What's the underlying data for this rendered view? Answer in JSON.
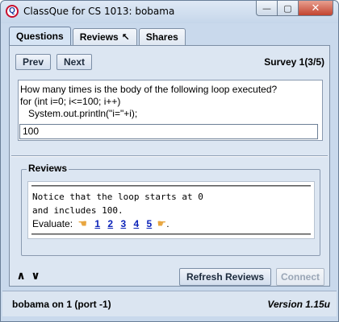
{
  "window": {
    "title": "ClassQue for CS 1013: bobama",
    "app_icon_letter": "Q",
    "min_glyph": "—",
    "max_glyph": "▢",
    "close_glyph": "✕"
  },
  "tabs": [
    {
      "label": "Questions",
      "active": true
    },
    {
      "label": "Reviews",
      "icon": "arrow-up-left-icon",
      "icon_glyph": "↖"
    },
    {
      "label": "Shares"
    }
  ],
  "nav": {
    "prev_label": "Prev",
    "next_label": "Next",
    "survey_label": "Survey 1",
    "survey_count": "(3/5)"
  },
  "question": {
    "lines": [
      "How many times is the body of the following loop executed?",
      "for (int i=0; i<=100; i++)",
      "   System.out.println(\"i=\"+i);"
    ],
    "answer_value": "100"
  },
  "reviews": {
    "legend": "Reviews",
    "lines": [
      "Notice that the loop starts at 0",
      "and includes 100."
    ],
    "evaluate_label": "Evaluate:",
    "ratings": [
      "1",
      "2",
      "3",
      "4",
      "5"
    ],
    "thumb_down_glyph": "☚",
    "thumb_up_glyph": "☛"
  },
  "controls": {
    "up_glyph": "∧",
    "down_glyph": "∨",
    "refresh_label": "Refresh Reviews",
    "connect_label": "Connect"
  },
  "status": {
    "left": "bobama on 1 (port -1)",
    "right": "Version 1.15u"
  }
}
